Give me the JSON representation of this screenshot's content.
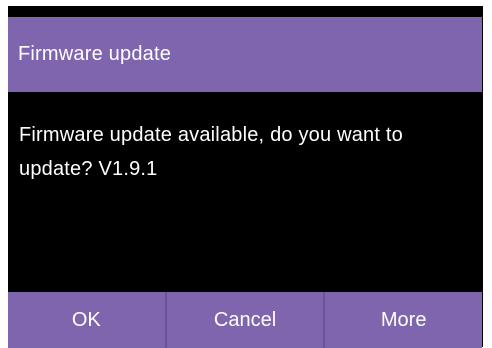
{
  "dialog": {
    "title": "Firmware update",
    "message": "Firmware update available, do you want to update?  V1.9.1",
    "buttons": {
      "ok": "OK",
      "cancel": "Cancel",
      "more": "More"
    }
  },
  "colors": {
    "accent": "#7f65ae",
    "background": "#000000",
    "text": "#ffffff"
  }
}
